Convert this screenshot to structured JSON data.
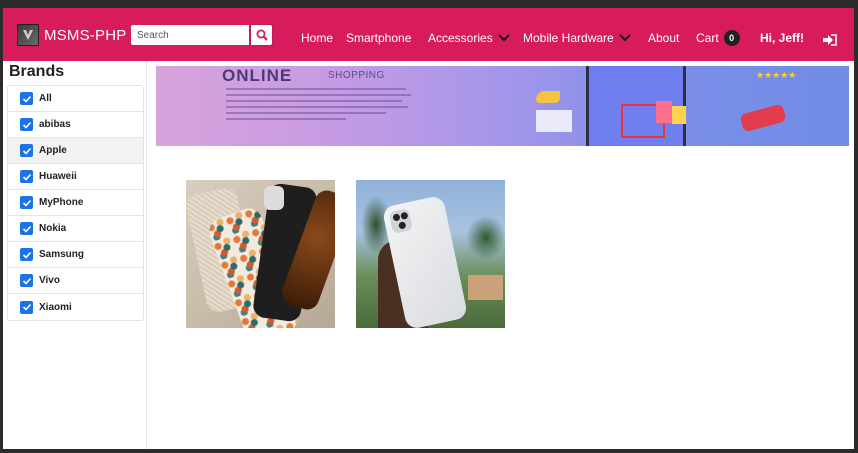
{
  "navbar": {
    "brand": "MSMS-PHP",
    "search_placeholder": "Search",
    "search_icon": "search-icon",
    "items": [
      {
        "label": "Home"
      },
      {
        "label": "Smartphone"
      },
      {
        "label": "Accessories"
      },
      {
        "label": "Mobile Hardware"
      },
      {
        "label": "About"
      }
    ],
    "cart": {
      "label": "Cart",
      "count": "0"
    },
    "greeting": "Hi, Jeff!",
    "logout_icon": "sign-out-icon",
    "background": "#d81b5c"
  },
  "sidebar": {
    "title": "Brands",
    "brands": [
      {
        "label": "All",
        "checked": true
      },
      {
        "label": "abibas",
        "checked": true
      },
      {
        "label": "Apple",
        "checked": true
      },
      {
        "label": "Huaweii",
        "checked": true
      },
      {
        "label": "MyPhone",
        "checked": true
      },
      {
        "label": "Nokia",
        "checked": true
      },
      {
        "label": "Samsung",
        "checked": true
      },
      {
        "label": "Vivo",
        "checked": true
      },
      {
        "label": "Xiaomi",
        "checked": true
      }
    ],
    "checkbox_color": "#1a73e8"
  },
  "banner": {
    "title": "ONLINE",
    "subtitle": "SHOPPING"
  }
}
